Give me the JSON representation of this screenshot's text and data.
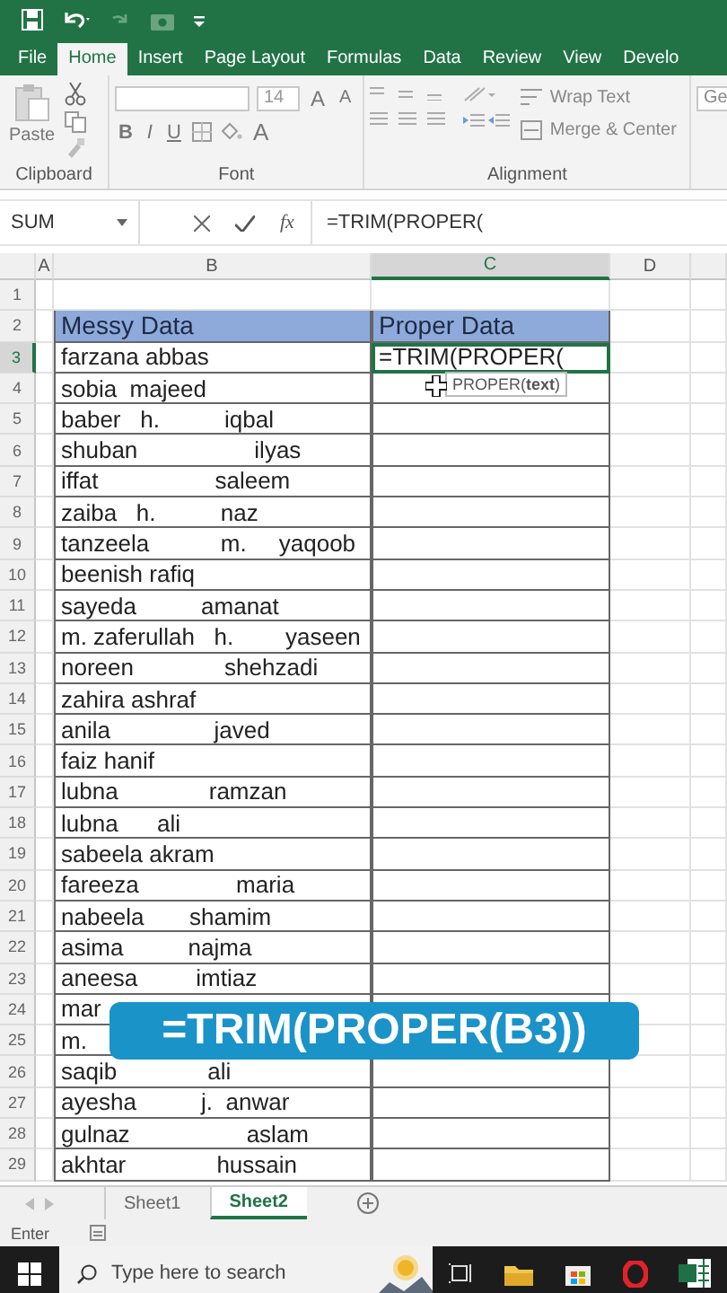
{
  "tabs": [
    {
      "label": "File",
      "selected": false
    },
    {
      "label": "Home",
      "selected": true
    },
    {
      "label": "Insert",
      "selected": false
    },
    {
      "label": "Page Layout",
      "selected": false
    },
    {
      "label": "Formulas",
      "selected": false
    },
    {
      "label": "Data",
      "selected": false
    },
    {
      "label": "Review",
      "selected": false
    },
    {
      "label": "View",
      "selected": false
    },
    {
      "label": "Develo",
      "selected": false
    }
  ],
  "ribbon": {
    "clipboard": {
      "paste": "Paste",
      "title": "Clipboard"
    },
    "font": {
      "size": "14",
      "grow": "A",
      "shrink": "A",
      "bold": "B",
      "italic": "I",
      "underline": "U",
      "font_color_label": "A",
      "title": "Font"
    },
    "alignment": {
      "wrap": "Wrap Text",
      "merge": "Merge & Center",
      "title": "Alignment"
    },
    "number": {
      "format": "Ge"
    }
  },
  "formula_bar": {
    "name_box": "SUM",
    "function_label": "fx",
    "formula": "=TRIM(PROPER("
  },
  "grid": {
    "columns": [
      {
        "label": "A",
        "selected": false
      },
      {
        "label": "B",
        "selected": false
      },
      {
        "label": "C",
        "selected": true
      },
      {
        "label": "D",
        "selected": false
      }
    ],
    "rows": [
      {
        "number": "1",
        "selected": false,
        "kind": "blank"
      },
      {
        "number": "2",
        "selected": false,
        "kind": "header",
        "b": "Messy Data",
        "c": "Proper Data"
      },
      {
        "number": "3",
        "selected": true,
        "kind": "data",
        "b": "farzana abbas",
        "c": "=TRIM(PROPER("
      },
      {
        "number": "4",
        "selected": false,
        "kind": "data",
        "b": "sobia  majeed"
      },
      {
        "number": "5",
        "selected": false,
        "kind": "data",
        "b": "baber   h.          iqbal"
      },
      {
        "number": "6",
        "selected": false,
        "kind": "data",
        "b": "shuban                  ilyas"
      },
      {
        "number": "7",
        "selected": false,
        "kind": "data",
        "b": "iffat                  saleem"
      },
      {
        "number": "8",
        "selected": false,
        "kind": "data",
        "b": "zaiba   h.          naz"
      },
      {
        "number": "9",
        "selected": false,
        "kind": "data",
        "b": "tanzeela           m.     yaqoob"
      },
      {
        "number": "10",
        "selected": false,
        "kind": "data",
        "b": "beenish rafiq"
      },
      {
        "number": "11",
        "selected": false,
        "kind": "data",
        "b": "sayeda          amanat"
      },
      {
        "number": "12",
        "selected": false,
        "kind": "data",
        "b": "m. zaferullah   h.        yaseen"
      },
      {
        "number": "13",
        "selected": false,
        "kind": "data",
        "b": "noreen              shehzadi"
      },
      {
        "number": "14",
        "selected": false,
        "kind": "data",
        "b": "zahira ashraf"
      },
      {
        "number": "15",
        "selected": false,
        "kind": "data",
        "b": "anila                javed"
      },
      {
        "number": "16",
        "selected": false,
        "kind": "data",
        "b": "faiz hanif"
      },
      {
        "number": "17",
        "selected": false,
        "kind": "data",
        "b": "lubna              ramzan"
      },
      {
        "number": "18",
        "selected": false,
        "kind": "data",
        "b": "lubna      ali"
      },
      {
        "number": "19",
        "selected": false,
        "kind": "data",
        "b": "sabeela akram"
      },
      {
        "number": "20",
        "selected": false,
        "kind": "data",
        "b": "fareeza               maria"
      },
      {
        "number": "21",
        "selected": false,
        "kind": "data",
        "b": "nabeela       shamim"
      },
      {
        "number": "22",
        "selected": false,
        "kind": "data",
        "b": "asima          najma"
      },
      {
        "number": "23",
        "selected": false,
        "kind": "data",
        "b": "aneesa         imtiaz"
      },
      {
        "number": "24",
        "selected": false,
        "kind": "data",
        "b": "mar"
      },
      {
        "number": "25",
        "selected": false,
        "kind": "data",
        "b": "m."
      },
      {
        "number": "26",
        "selected": false,
        "kind": "data",
        "b": "saqib              ali"
      },
      {
        "number": "27",
        "selected": false,
        "kind": "data",
        "b": "ayesha          j.  anwar"
      },
      {
        "number": "28",
        "selected": false,
        "kind": "data",
        "b": "gulnaz                  aslam"
      },
      {
        "number": "29",
        "selected": false,
        "kind": "data",
        "b": "akhtar              hussain"
      }
    ]
  },
  "tooltip": "PROPER(**text**)",
  "caption": "=TRIM(PROPER(B3))",
  "sheets": [
    {
      "label": "Sheet1",
      "selected": false
    },
    {
      "label": "Sheet2",
      "selected": true
    }
  ],
  "status_bar": {
    "mode": "Enter"
  },
  "taskbar": {
    "search": {
      "placeholder": "Type here to search"
    }
  }
}
